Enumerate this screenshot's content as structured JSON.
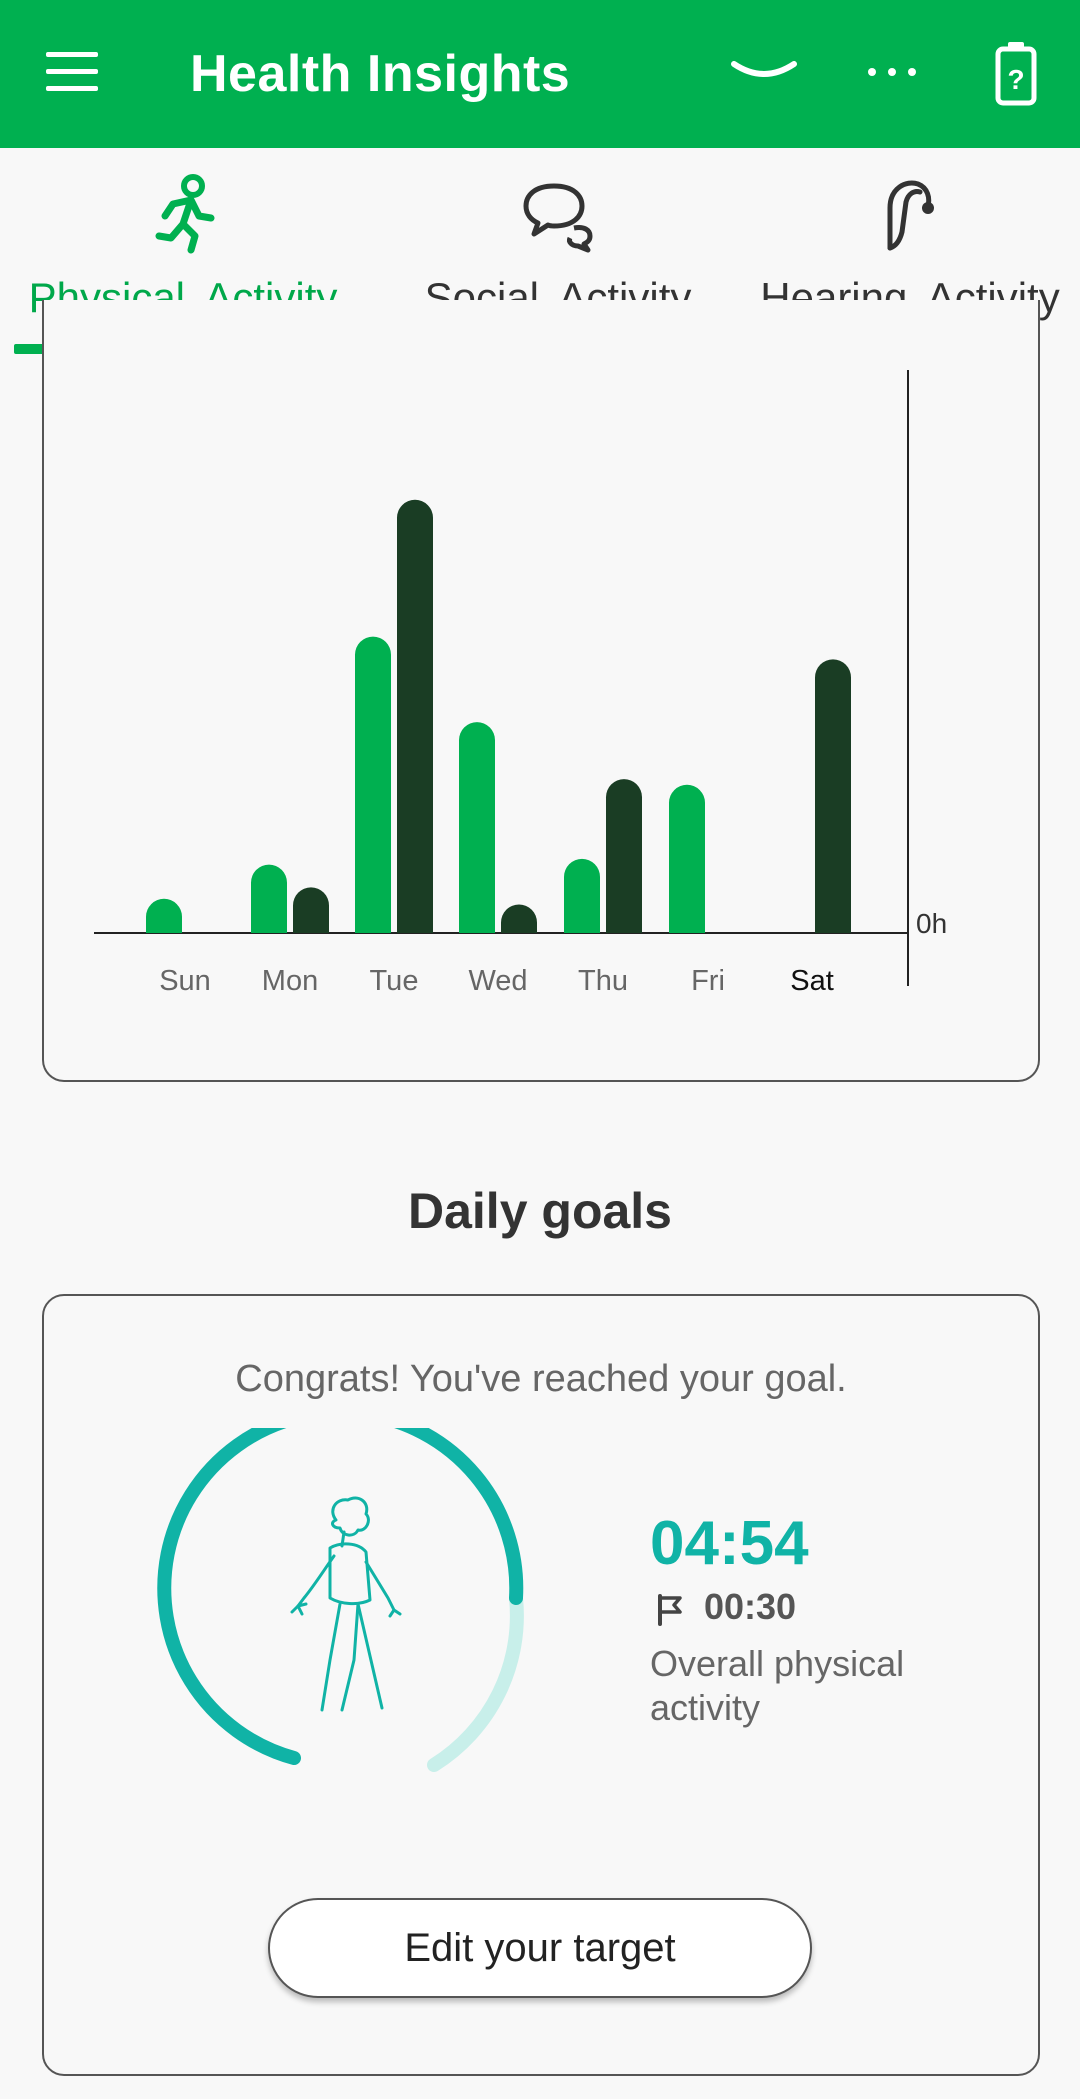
{
  "app": {
    "title": "Health Insights",
    "brand_color": "#00b050"
  },
  "tabs": [
    {
      "label": "Physical  Activity",
      "icon": "walking-person-icon",
      "active": true
    },
    {
      "label": "Social  Activity",
      "icon": "speech-bubbles-icon",
      "active": false
    },
    {
      "label": "Hearing  Activity",
      "icon": "hearing-aid-icon",
      "active": false
    }
  ],
  "chart_data": {
    "type": "bar",
    "categories": [
      "Sun",
      "Mon",
      "Tue",
      "Wed",
      "Thu",
      "Fri",
      "Sat"
    ],
    "highlighted_category": "Sat",
    "y_axis_label": "0h",
    "series": [
      {
        "color": "#00b050",
        "values": [
          0.6,
          1.2,
          5.2,
          3.7,
          1.3,
          2.6,
          0
        ]
      },
      {
        "color": "#1a3d24",
        "values": [
          0,
          0.8,
          7.6,
          0.5,
          2.7,
          0,
          4.8
        ]
      }
    ]
  },
  "daily_goals": {
    "title": "Daily goals",
    "message": "Congrats! You've reached your goal.",
    "activity_time": "04:54",
    "target_time": "00:30",
    "description": "Overall physical activity",
    "edit_button": "Edit your target",
    "accent_color": "#10b3a6"
  }
}
